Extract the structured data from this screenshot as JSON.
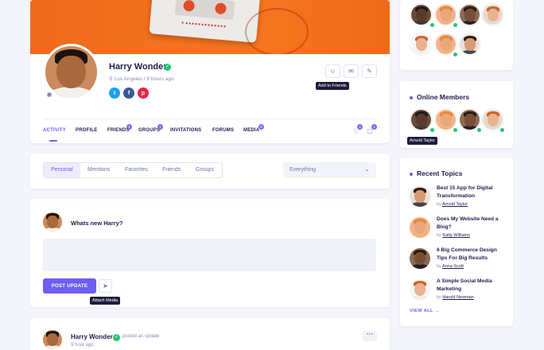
{
  "profile": {
    "name": "Harry Wonder",
    "meta": "Los Angeles / 9 hours ago",
    "social": [
      "t",
      "f",
      "p"
    ],
    "tooltip_add_friend": "Add to Friends"
  },
  "tabs": [
    {
      "label": "ACTIVITY"
    },
    {
      "label": "PROFILE"
    },
    {
      "label": "FRIENDS",
      "badge": "1"
    },
    {
      "label": "GROUPS",
      "badge": "1"
    },
    {
      "label": "INVITATIONS"
    },
    {
      "label": "FORUMS"
    },
    {
      "label": "MEDIA",
      "badge": "5"
    }
  ],
  "header_icons": {
    "notifications_badge": "4",
    "messages_badge": "1"
  },
  "filter": {
    "tabs": [
      "Personal",
      "Mentions",
      "Favorites",
      "Friends",
      "Groups"
    ],
    "select_value": "Everything"
  },
  "composer": {
    "prompt": "Whats new Harry?",
    "post_button": "POST UPDATE",
    "attach_tooltip": "Attach Media"
  },
  "activity": {
    "name": "Harry Wonder",
    "verb": "posted an update",
    "time": "9 hour ago"
  },
  "online": {
    "title": "Online Members",
    "tooltip": "Arnold Taylor"
  },
  "topics": {
    "title": "Recent Topics",
    "by_prefix": "by",
    "items": [
      {
        "title": "Best 15 App for Digital Transformation",
        "author": "Arnold Taylor"
      },
      {
        "title": "Does My Website Need a Blog?",
        "author": "Katty Williams"
      },
      {
        "title": "6 Big Commerce Design Tips For Big Results",
        "author": "Anna Scott"
      },
      {
        "title": "A Simple Social Media Marketing",
        "author": "Harold Newman"
      }
    ],
    "view_all": "VIEW ALL →"
  },
  "colors": {
    "accent": "#6e5ef5",
    "online": "#23c477",
    "cover": "#f7761f"
  },
  "icons": [
    "camera-icon",
    "twitter-icon",
    "facebook-icon",
    "pinterest-icon",
    "user-add-icon",
    "mail-icon",
    "pencil-icon",
    "bell-icon",
    "chat-icon",
    "chevron-down-icon",
    "paperclip-icon",
    "more-icon",
    "check-icon"
  ]
}
